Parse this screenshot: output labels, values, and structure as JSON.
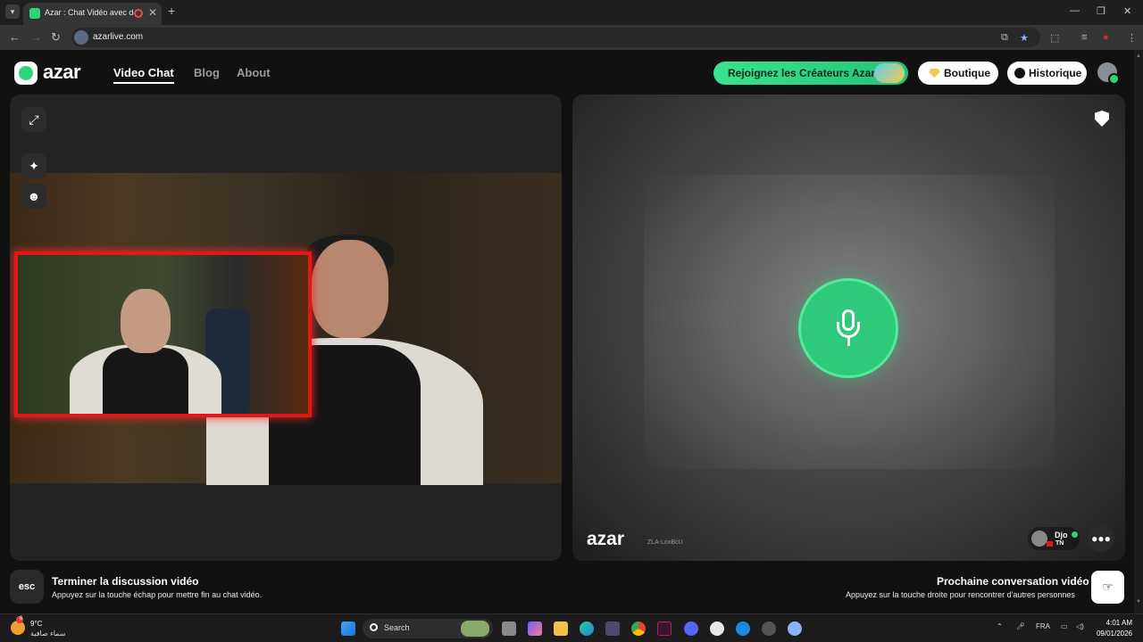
{
  "browser": {
    "tab_title": "Azar : Chat Vidéo avec de n",
    "url": "azarlive.com",
    "tab_close": "✕",
    "new_tab": "+"
  },
  "nav": {
    "logo_text": "azar",
    "items": [
      {
        "label": "Video Chat",
        "active": true
      },
      {
        "label": "Blog",
        "active": false
      },
      {
        "label": "About",
        "active": false
      }
    ],
    "creators_label": "Rejoignez les Créateurs Azar",
    "shop_label": "Boutique",
    "history_label": "Historique"
  },
  "stage": {
    "watermark": "azar",
    "session_id": "ZLA-LoxBcU",
    "peer": {
      "name": "Djo",
      "country": "TN"
    }
  },
  "bottom": {
    "esc_key": "esc",
    "end_title": "Terminer la discussion vidéo",
    "end_sub": "Appuyez sur la touche échap pour mettre fin au chat vidéo.",
    "next_title": "Prochaine conversation vidéo",
    "next_sub": "Appuyez sur la touche droite pour rencontrer d'autres personnes"
  },
  "taskbar": {
    "weather_temp": "9°C",
    "weather_desc": "سماء صافية",
    "weather_badge": "6",
    "search_placeholder": "Search",
    "lang": "FRA",
    "time": "4:01 AM",
    "date": "09/01/2026"
  },
  "colors": {
    "accent": "#2ed47a",
    "frame_red": "#e11818"
  }
}
